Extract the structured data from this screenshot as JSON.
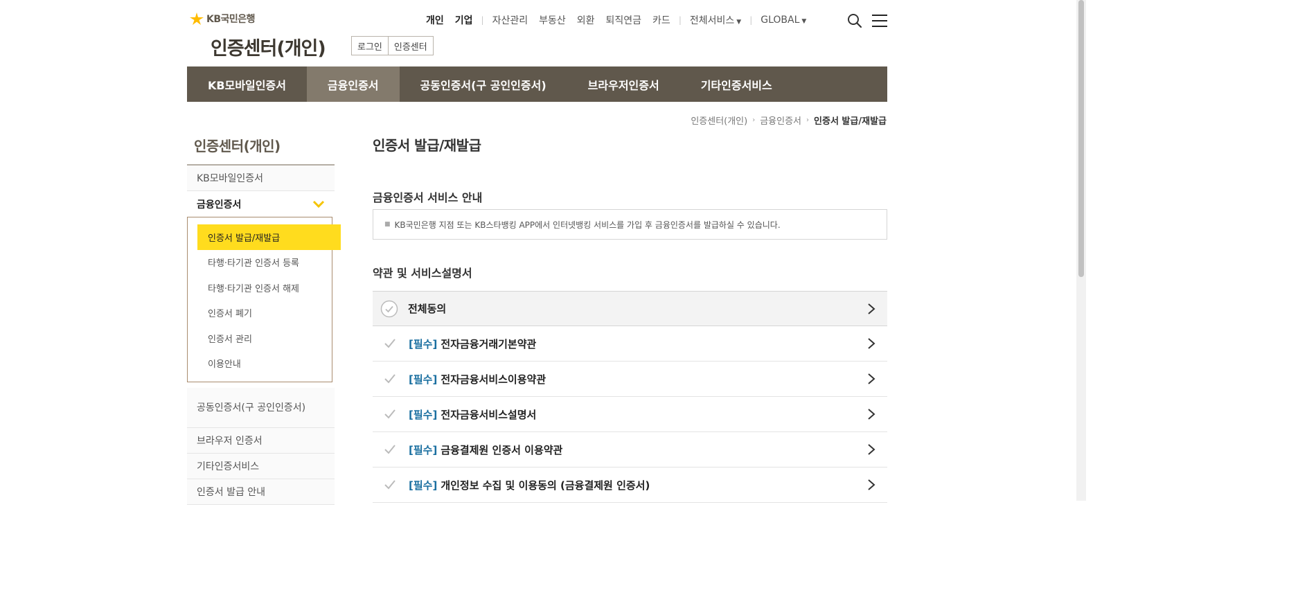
{
  "header": {
    "logo_text": "KB국민은행",
    "site_title": "인증센터(개인)",
    "buttons": [
      "로그인",
      "인증센터"
    ],
    "gnb": {
      "primary": [
        "개인",
        "기업"
      ],
      "secondary": [
        "자산관리",
        "부동산",
        "외환",
        "퇴직연금",
        "카드"
      ],
      "all_services": "전체서비스",
      "global": "GLOBAL"
    }
  },
  "mainnav": {
    "tabs": [
      "KB모바일인증서",
      "금융인증서",
      "공동인증서(구 공인인증서)",
      "브라우저인증서",
      "기타인증서비스"
    ],
    "active_index": 1
  },
  "breadcrumb": [
    "인증센터(개인)",
    "금융인증서",
    "인증서 발급/재발급"
  ],
  "lnb": {
    "title": "인증센터(개인)",
    "items": {
      "kbmobile": "KB모바일인증서",
      "financial": "금융인증서",
      "joint": "공동인증서(구 공인인증서)",
      "browser": "브라우저 인증서",
      "other": "기타인증서비스",
      "guide": "인증서 발급 안내"
    },
    "submenu": [
      "인증서 발급/재발급",
      "타행·타기관 인증서 등록",
      "타행·타기관 인증서 해제",
      "인증서 폐기",
      "인증서 관리",
      "이용안내"
    ]
  },
  "content": {
    "page_title": "인증서 발급/재발급",
    "section1_title": "금융인증서 서비스 안내",
    "notice": "KB국민은행 지점 또는 KB스타뱅킹 APP에서 인터넷뱅킹 서비스를 가입 후 금융인증서를 발급하실 수 있습니다.",
    "section2_title": "약관 및 서비스설명서",
    "agree_all": "전체동의",
    "required_tag": "[필수]",
    "terms": [
      "전자금융거래기본약관",
      "전자금융서비스이용약관",
      "전자금융서비스설명서",
      "금융결제원 인증서 이용약관",
      "개인정보 수집 및 이용동의 (금융결제원 인증서)"
    ]
  },
  "colors": {
    "nav_bg": "#60584c",
    "nav_active": "#837a6c",
    "accent_yellow": "#ffdc1e",
    "required_blue": "#1a6fa0"
  }
}
